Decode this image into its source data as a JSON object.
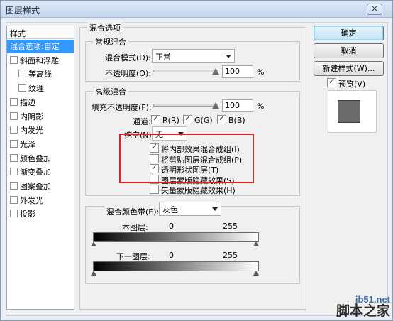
{
  "window": {
    "title": "图层样式",
    "close_glyph": "✕"
  },
  "style_list": {
    "header": "样式",
    "items": [
      {
        "label": "混合选项:自定",
        "checkbox": false,
        "checked": false,
        "selected": true,
        "indent": false
      },
      {
        "label": "斜面和浮雕",
        "checkbox": true,
        "checked": false,
        "selected": false,
        "indent": false
      },
      {
        "label": "等高线",
        "checkbox": true,
        "checked": false,
        "selected": false,
        "indent": true
      },
      {
        "label": "纹理",
        "checkbox": true,
        "checked": false,
        "selected": false,
        "indent": true
      },
      {
        "label": "描边",
        "checkbox": true,
        "checked": false,
        "selected": false,
        "indent": false
      },
      {
        "label": "内阴影",
        "checkbox": true,
        "checked": false,
        "selected": false,
        "indent": false
      },
      {
        "label": "内发光",
        "checkbox": true,
        "checked": false,
        "selected": false,
        "indent": false
      },
      {
        "label": "光泽",
        "checkbox": true,
        "checked": false,
        "selected": false,
        "indent": false
      },
      {
        "label": "颜色叠加",
        "checkbox": true,
        "checked": false,
        "selected": false,
        "indent": false
      },
      {
        "label": "渐变叠加",
        "checkbox": true,
        "checked": false,
        "selected": false,
        "indent": false
      },
      {
        "label": "图案叠加",
        "checkbox": true,
        "checked": false,
        "selected": false,
        "indent": false
      },
      {
        "label": "外发光",
        "checkbox": true,
        "checked": false,
        "selected": false,
        "indent": false
      },
      {
        "label": "投影",
        "checkbox": true,
        "checked": false,
        "selected": false,
        "indent": false
      }
    ]
  },
  "blend_options": {
    "title": "混合选项",
    "general": {
      "title": "常规混合",
      "blend_mode_label": "混合模式(D):",
      "blend_mode_value": "正常",
      "opacity_label": "不透明度(O):",
      "opacity_value": "100",
      "opacity_unit": "%"
    },
    "advanced": {
      "title": "高级混合",
      "fill_opacity_label": "填充不透明度(F):",
      "fill_opacity_value": "100",
      "fill_opacity_unit": "%",
      "channels_label": "通道:",
      "channels": [
        {
          "label": "R(R)",
          "checked": true
        },
        {
          "label": "G(G)",
          "checked": true
        },
        {
          "label": "B(B)",
          "checked": true
        }
      ],
      "knockout_label": "挖空(N):",
      "knockout_value": "无",
      "options": [
        {
          "label": "将内部效果混合成组(I)",
          "checked": true
        },
        {
          "label": "将剪贴图层混合成组(P)",
          "checked": false
        },
        {
          "label": "透明形状图层(T)",
          "checked": true
        },
        {
          "label": "图层蒙版隐藏效果(S)",
          "checked": false
        },
        {
          "label": "矢量蒙版隐藏效果(H)",
          "checked": false
        }
      ]
    },
    "blend_if": {
      "label": "混合颜色带(E):",
      "value": "灰色",
      "this_layer_label": "本图层:",
      "this_layer_min": "0",
      "this_layer_max": "255",
      "underlying_label": "下一图层:",
      "underlying_min": "0",
      "underlying_max": "255"
    }
  },
  "buttons": {
    "ok": "确定",
    "cancel": "取消",
    "new_style": "新建样式(W)...",
    "preview_label": "预览(V)",
    "preview_checked": true
  },
  "watermark": {
    "line1": "jb51.net",
    "line2": "脚本之家"
  },
  "colors": {
    "selection": "#3399ff",
    "highlight_box": "#e02020",
    "preview_swatch": "#6b6b6b"
  }
}
